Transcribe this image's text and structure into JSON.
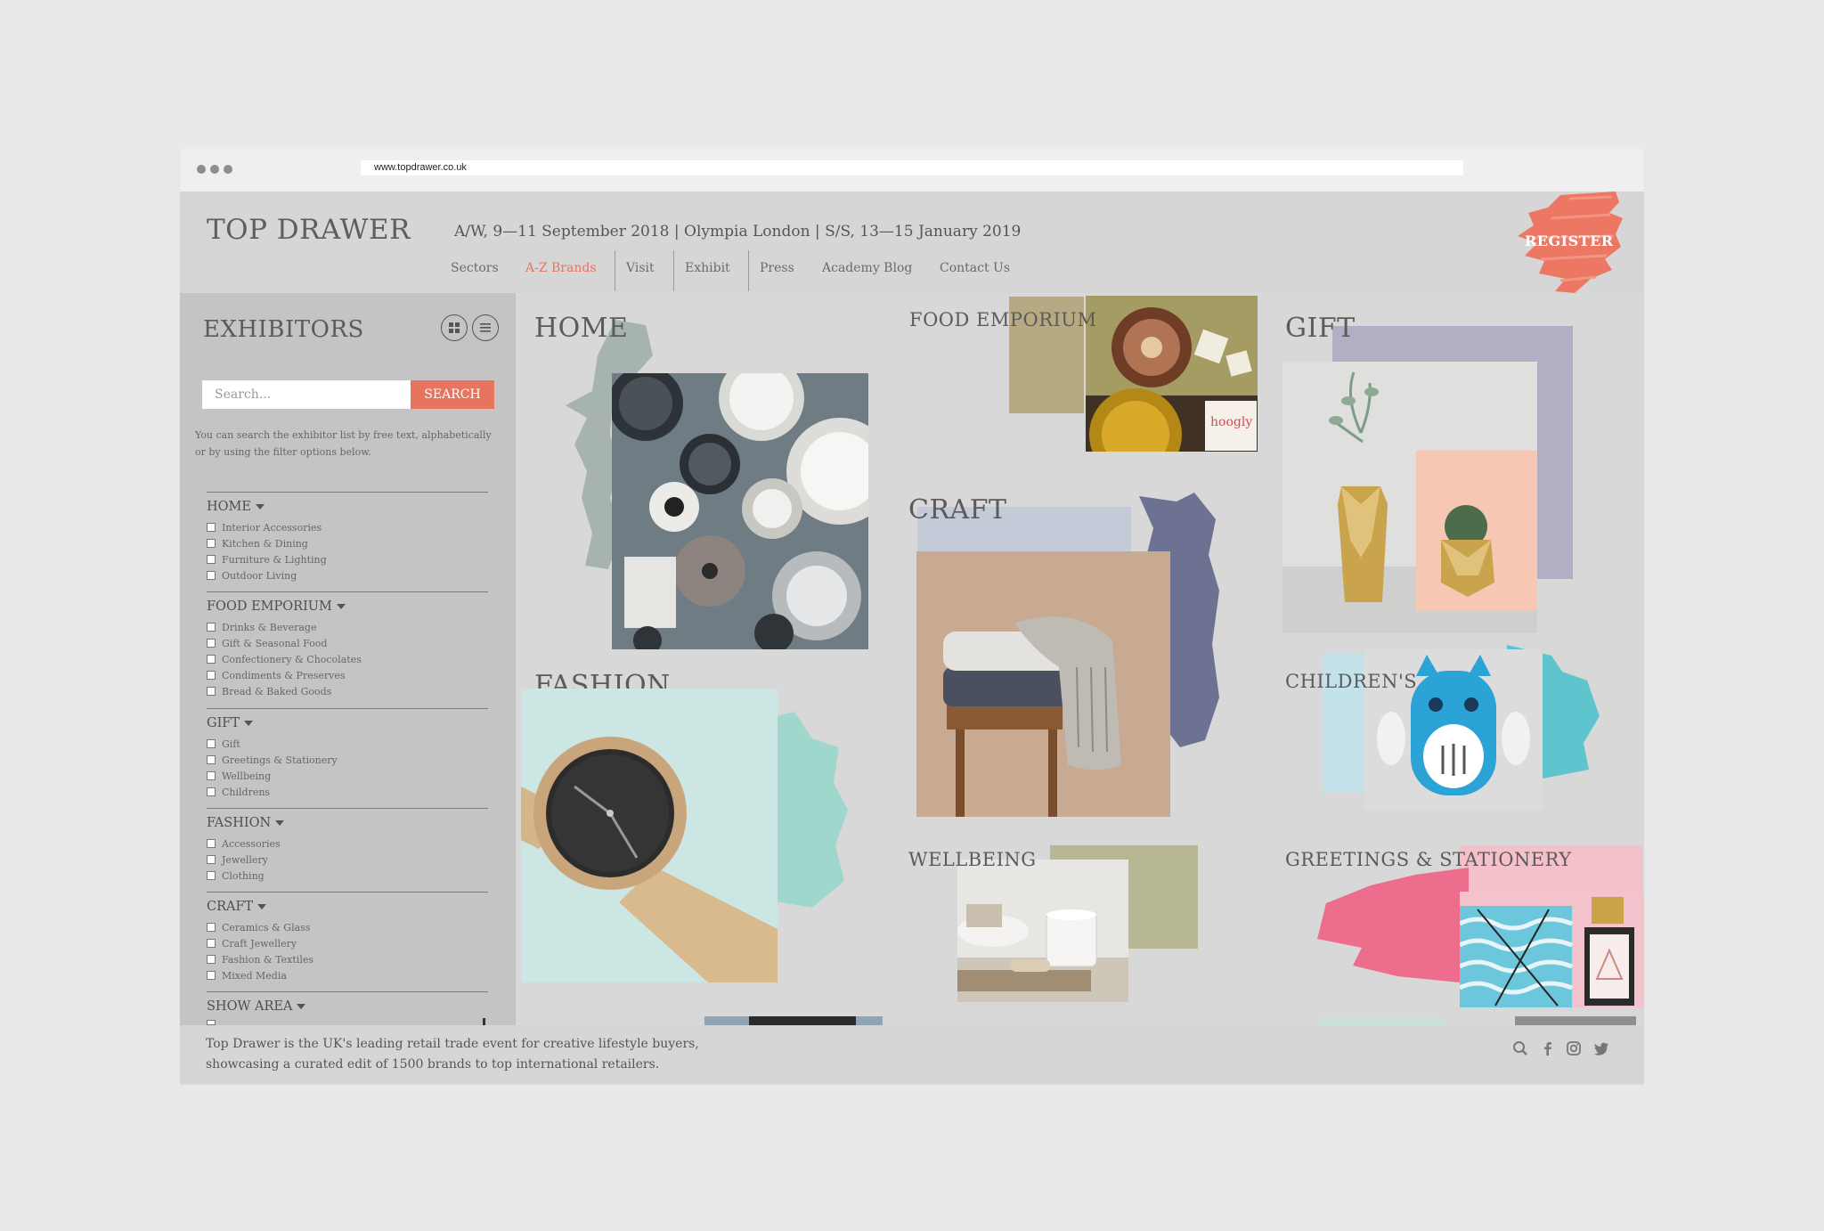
{
  "browser": {
    "url": "www.topdrawer.co.uk"
  },
  "header": {
    "logo": "TOP DRAWER",
    "dates": "A/W, 9—11 September 2018 | Olympia London | S/S, 13—15 January 2019",
    "nav": [
      "Sectors",
      "A-Z Brands",
      "Visit",
      "Exhibit",
      "Press",
      "Academy Blog",
      "Contact Us"
    ],
    "active_nav": "A-Z Brands",
    "register": "REGISTER",
    "accent_color": "#e8735f"
  },
  "sidebar": {
    "title": "EXHIBITORS",
    "view_icons": [
      "grid-icon",
      "list-icon"
    ],
    "search_placeholder": "Search...",
    "search_button": "SEARCH",
    "help_text": "You can search the exhibitor list by free text, alphabetically or by using the filter options below.",
    "categories": [
      {
        "title": "HOME",
        "options": [
          "Interior Accessories",
          "Kitchen & Dining",
          "Furniture & Lighting",
          "Outdoor Living"
        ]
      },
      {
        "title": "FOOD EMPORIUM",
        "options": [
          "Drinks & Beverage",
          "Gift & Seasonal Food",
          "Confectionery & Chocolates",
          "Condiments & Preserves",
          "Bread & Baked Goods"
        ]
      },
      {
        "title": "GIFT",
        "options": [
          "Gift",
          "Greetings & Stationery",
          "Wellbeing",
          "Childrens"
        ]
      },
      {
        "title": "FASHION",
        "options": [
          "Accessories",
          "Jewellery",
          "Clothing"
        ]
      },
      {
        "title": "CRAFT",
        "options": [
          "Ceramics & Glass",
          "Craft Jewellery",
          "Fashion & Textiles",
          "Mixed Media"
        ]
      },
      {
        "title": "SHOW AREA",
        "options": []
      }
    ]
  },
  "sections": {
    "home": "HOME",
    "food": "FOOD EMPORIUM",
    "gift": "GIFT",
    "craft": "CRAFT",
    "fashion": "FASHION",
    "childrens": "CHILDREN'S",
    "wellbeing": "WELLBEING",
    "greetings": "GREETINGS & STATIONERY",
    "hoogly_label": "hoogly"
  },
  "footer": {
    "line1": "Top Drawer is the UK's leading retail trade event for creative lifestyle buyers,",
    "line2": "showcasing a curated edit of 1500 brands to top international retailers.",
    "social_icons": [
      "search-icon",
      "facebook-icon",
      "instagram-icon",
      "twitter-icon"
    ]
  }
}
